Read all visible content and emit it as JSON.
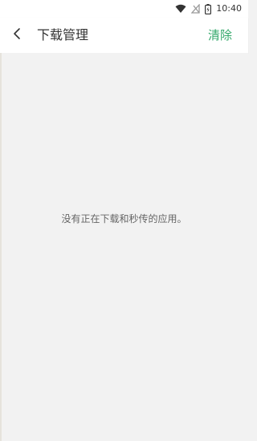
{
  "status_bar": {
    "time": "10:40",
    "icons": [
      "wifi-icon",
      "no-signal-icon",
      "battery-icon"
    ]
  },
  "app_bar": {
    "title": "下载管理",
    "back_icon": "chevron-left-icon",
    "clear_label": "清除",
    "accent_color": "#34a86b"
  },
  "content": {
    "empty_message": "没有正在下载和秒传的应用。"
  }
}
